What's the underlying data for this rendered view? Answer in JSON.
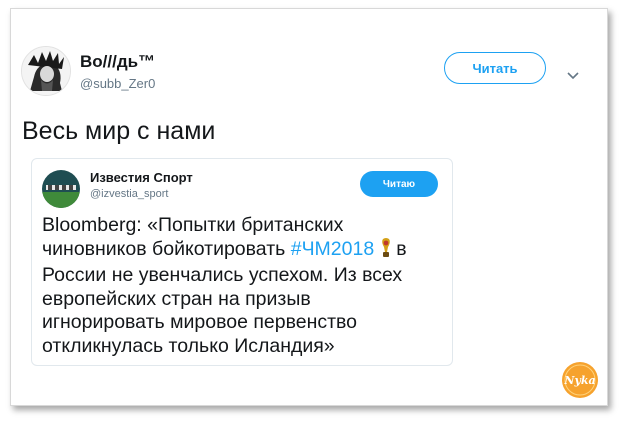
{
  "tweet": {
    "display_name": "Во///дь™",
    "handle": "@subb_Zer0",
    "follow_label": "Читать",
    "text": "Весь мир с нами"
  },
  "quoted": {
    "display_name": "Известия Спорт",
    "handle": "@izvestia_sport",
    "follow_label": "Читаю",
    "text_before_hashtag": "Bloomberg: «Попытки британских",
    "line2_start": "чиновников бойкотировать ",
    "hashtag": "#ЧМ2018",
    "line2_end": "в",
    "line3": "России не увенчались успехом. Из всех",
    "line4": "европейских стран на призыв",
    "line5": "игнорировать мировое первенство",
    "line6": "откликнулась только Исландия»"
  },
  "watermark": {
    "text": "Nyka"
  },
  "colors": {
    "accent": "#1da1f2",
    "text": "#14171a",
    "muted": "#657786",
    "watermark": "#f59a1b"
  },
  "icons": {
    "chevron": "chevron-down-icon",
    "cup": "world-cup-trophy-icon"
  }
}
